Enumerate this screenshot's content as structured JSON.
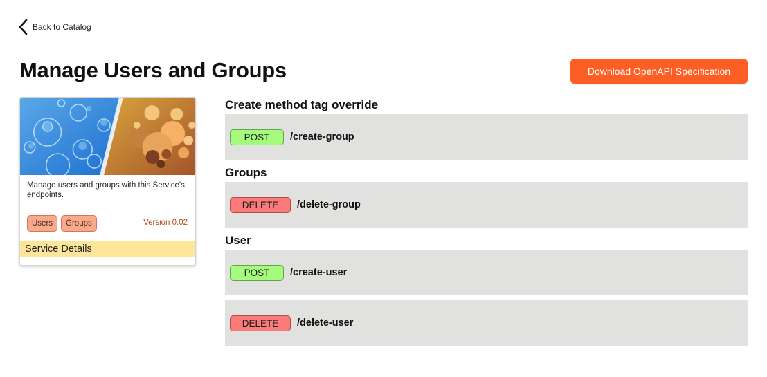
{
  "nav": {
    "back_label": "Back to Catalog"
  },
  "header": {
    "title": "Manage Users and Groups",
    "download_label": "Download OpenAPI Specification"
  },
  "card": {
    "description": "Manage users and groups with this Service's endpoints.",
    "tags": [
      "Users",
      "Groups"
    ],
    "version": "Version 0.02",
    "details_label": "Service Details"
  },
  "sections": [
    {
      "title": "Create method tag override",
      "endpoints": [
        {
          "method": "POST",
          "path": "/create-group"
        }
      ]
    },
    {
      "title": "Groups",
      "endpoints": [
        {
          "method": "DELETE",
          "path": "/delete-group"
        }
      ]
    },
    {
      "title": "User",
      "endpoints": [
        {
          "method": "POST",
          "path": "/create-user"
        },
        {
          "method": "DELETE",
          "path": "/delete-user"
        }
      ]
    }
  ],
  "colors": {
    "accent": "#fd5e24",
    "post": "#a5fb7c",
    "delete": "#fb7b7b",
    "tag": "#fca88b",
    "details_bar": "#fde59a",
    "endpoint_bg": "#e1e1df"
  }
}
